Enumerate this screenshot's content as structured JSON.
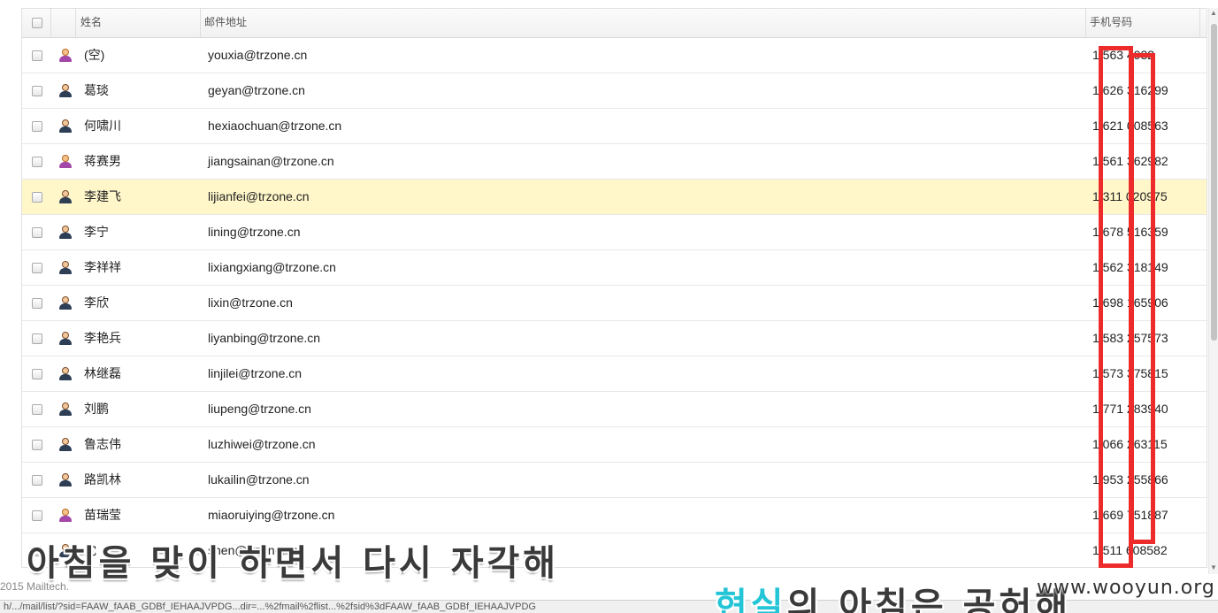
{
  "columns": {
    "name": "姓名",
    "email": "邮件地址",
    "phone": "手机号码"
  },
  "rows": [
    {
      "name": "(空)",
      "email": "youxia@trzone.cn",
      "phone": "1 563  4932",
      "avatar": "female-user-icon"
    },
    {
      "name": "葛琰",
      "email": "geyan@trzone.cn",
      "phone": "1 626 316299",
      "avatar": "male-user-icon"
    },
    {
      "name": "何啸川",
      "email": "hexiaochuan@trzone.cn",
      "phone": "1 621 008563",
      "avatar": "male-user-icon"
    },
    {
      "name": "蒋赛男",
      "email": "jiangsainan@trzone.cn",
      "phone": "1 561 362982",
      "avatar": "female-user-icon"
    },
    {
      "name": "李建飞",
      "email": "lijianfei@trzone.cn",
      "phone": "1 311 020975",
      "avatar": "male-user-icon",
      "highlighted": true
    },
    {
      "name": "李宁",
      "email": "lining@trzone.cn",
      "phone": "1 678 516359",
      "avatar": "male-user-icon"
    },
    {
      "name": "李祥祥",
      "email": "lixiangxiang@trzone.cn",
      "phone": "1 562 318149",
      "avatar": "male-user-icon"
    },
    {
      "name": "李欣",
      "email": "lixin@trzone.cn",
      "phone": "1 698 165906",
      "avatar": "male-user-icon"
    },
    {
      "name": "李艳兵",
      "email": "liyanbing@trzone.cn",
      "phone": "1 583 257573",
      "avatar": "male-user-icon"
    },
    {
      "name": "林继磊",
      "email": "linjilei@trzone.cn",
      "phone": "1 573 375815",
      "avatar": "male-user-icon"
    },
    {
      "name": "刘鹏",
      "email": "liupeng@trzone.cn",
      "phone": "1 771 283940",
      "avatar": "male-user-icon"
    },
    {
      "name": "鲁志伟",
      "email": "luzhiwei@trzone.cn",
      "phone": "1 066 263115",
      "avatar": "male-user-icon"
    },
    {
      "name": "路凯林",
      "email": "lukailin@trzone.cn",
      "phone": "1 953 255866",
      "avatar": "male-user-icon"
    },
    {
      "name": "苗瑞莹",
      "email": "miaoruiying@trzone.cn",
      "phone": "1 669 751887",
      "avatar": "female-user-icon"
    },
    {
      "name": "沈",
      "email": "shen@trzone.cn",
      "phone": "1 511 608582",
      "avatar": "male-user-icon"
    }
  ],
  "footer": {
    "copyright": "2015 Mailtech."
  },
  "status_bar": {
    "url": "h/.../mail/list/?sid=FAAW_fAAB_GDBf_IEHAAJVPDG...dir=...%2fmail%2flist...%2fsid%3dFAAW_fAAB_GDBf_IEHAAJVPDG"
  },
  "subtitle": {
    "line1": "아침을 맞이 하면서 다시 자각해",
    "line2_accent": "현실",
    "line2_rest": "의 아침은 공허해"
  },
  "watermark": "www.wooyun.org",
  "colors": {
    "highlight_row": "#fff7c9",
    "annotation_red": "#ee2b2b",
    "subtitle_accent": "#24c5d6"
  }
}
